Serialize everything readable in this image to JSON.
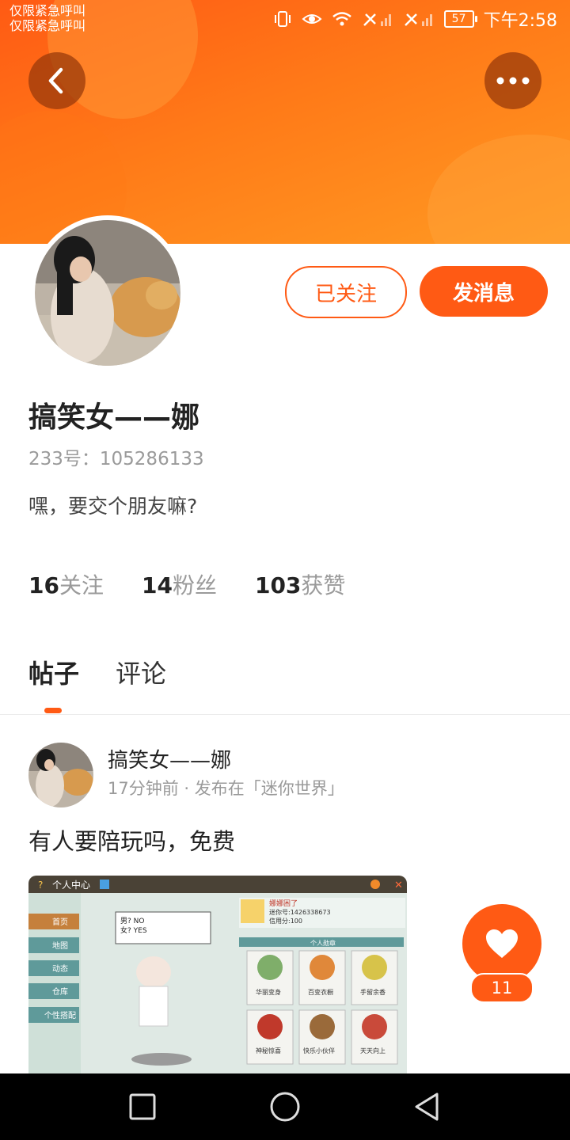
{
  "status_bar": {
    "emergency_line1": "仅限紧急呼叫",
    "emergency_line2": "仅限紧急呼叫",
    "battery": "57",
    "time": "下午2:58"
  },
  "header": {
    "back_icon": "chevron-left-icon",
    "more_icon": "more-dots-icon",
    "accent_color": "#ff5a14"
  },
  "profile": {
    "name": "搞笑女——娜",
    "id_line": "233号：105286133",
    "bio": "嘿，要交个朋友嘛?",
    "following_button": "已关注",
    "message_button": "发消息",
    "stats": [
      {
        "num": "16",
        "label": "关注"
      },
      {
        "num": "14",
        "label": "粉丝"
      },
      {
        "num": "103",
        "label": "获赞"
      }
    ]
  },
  "tabs": {
    "posts": "帖子",
    "comments": "评论"
  },
  "post": {
    "author": "搞笑女——娜",
    "meta": "17分钟前 · 发布在「迷你世界」",
    "text": "有人要陪玩吗，免费",
    "like_count": "11",
    "image": {
      "title": "个人中心",
      "menu": [
        "首页",
        "地图",
        "动态",
        "仓库",
        "个性搭配"
      ],
      "bubble_line1": "男? NO",
      "bubble_line2": "女? YES",
      "user_name": "娜娜困了",
      "user_id": "迷你号:1426338673",
      "credit": "信用分:100",
      "badge_header": "个人勋章",
      "badges": [
        "华丽变身",
        "百变衣橱",
        "手留余香",
        "神秘惊喜",
        "快乐小伙伴",
        "天天向上"
      ]
    }
  }
}
